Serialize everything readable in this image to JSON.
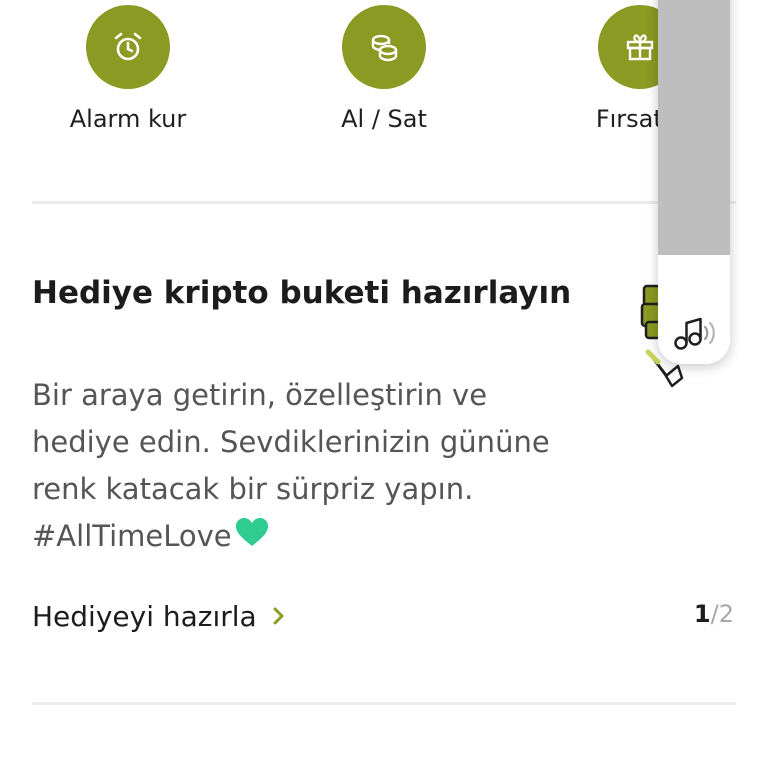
{
  "quick_actions": [
    {
      "label": "Alarm kur",
      "icon": "alarm-clock-icon"
    },
    {
      "label": "Al / Sat",
      "icon": "coins-icon"
    },
    {
      "label": "Fırsatla",
      "icon": "gift-icon"
    }
  ],
  "card": {
    "title": "Hediye kripto buketi hazırlayın",
    "description": "Bir araya getirin, özelleştirin ve hediye edin. Sevdiklerinizin gününe renk katacak bir sürpriz yapın. #AllTimeLove",
    "description_emoji": "green-heart-icon",
    "link_label": "Hediyeyi hazırla",
    "pager_current": "1",
    "pager_separator": "/",
    "pager_total": "2"
  },
  "audio_widget": {
    "icon": "music-note-icon"
  },
  "colors": {
    "accent": "#8a9a23",
    "heart": "#2ecc8f",
    "divider": "#ececec",
    "muted_text": "#555555"
  }
}
